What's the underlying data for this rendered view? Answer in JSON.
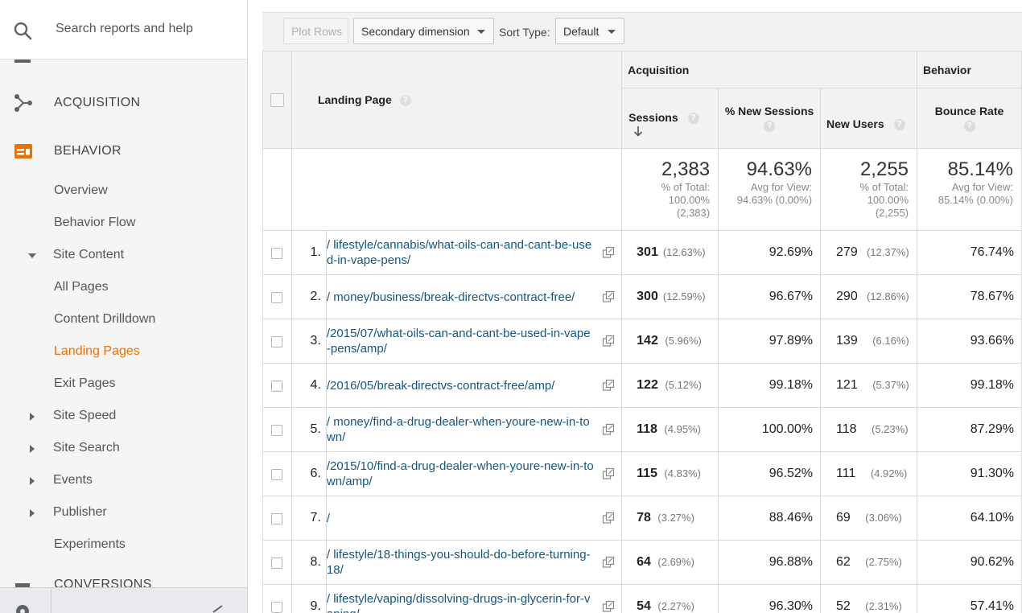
{
  "sidebar": {
    "search_placeholder": "Search reports and help",
    "sections": {
      "acquisition": "ACQUISITION",
      "behavior": "BEHAVIOR",
      "conversions": "CONVERSIONS"
    },
    "items": [
      {
        "label": "Overview"
      },
      {
        "label": "Behavior Flow"
      },
      {
        "label": "Site Content"
      },
      {
        "label": "All Pages"
      },
      {
        "label": "Content Drilldown"
      },
      {
        "label": "Landing Pages"
      },
      {
        "label": "Exit Pages"
      },
      {
        "label": "Site Speed"
      },
      {
        "label": "Site Search"
      },
      {
        "label": "Events"
      },
      {
        "label": "Publisher"
      },
      {
        "label": "Experiments"
      }
    ],
    "accent_color": "#e8710a"
  },
  "toolbar": {
    "plot_rows": "Plot Rows",
    "secondary_dimension": "Secondary dimension",
    "sort_type_label": "Sort Type:",
    "sort_type_value": "Default"
  },
  "table": {
    "groups": {
      "acquisition": "Acquisition",
      "behavior": "Behavior"
    },
    "columns": {
      "landing_page": "Landing Page",
      "sessions": "Sessions",
      "pct_new_sessions": "% New Sessions",
      "new_users": "New Users",
      "bounce_rate": "Bounce Rate"
    },
    "totals": {
      "sessions": {
        "value": "2,383",
        "l1": "% of Total:",
        "l2": "100.00%",
        "l3": "(2,383)"
      },
      "pct_new_sessions": {
        "value": "94.63%",
        "l1": "Avg for View:",
        "l2": "94.63% (0.00%)"
      },
      "new_users": {
        "value": "2,255",
        "l1": "% of Total:",
        "l2": "100.00%",
        "l3": "(2,255)"
      },
      "bounce_rate": {
        "value": "85.14%",
        "l1": "Avg for View:",
        "l2": "85.14% (0.00%)"
      }
    },
    "rows": [
      {
        "idx": "1.",
        "page": "/ lifestyle/cannabis/what-oils-can-and-cant-be-used-in-vape-pens/",
        "sessions": "301",
        "sessions_pct": "(12.63%)",
        "new_sessions": "92.69%",
        "new_users": "279",
        "new_users_pct": "(12.37%)",
        "bounce": "76.74%"
      },
      {
        "idx": "2.",
        "page": "/ money/business/break-directvs-contract-free/",
        "sessions": "300",
        "sessions_pct": "(12.59%)",
        "new_sessions": "96.67%",
        "new_users": "290",
        "new_users_pct": "(12.86%)",
        "bounce": "78.67%"
      },
      {
        "idx": "3.",
        "page": "/2015/07/what-oils-can-and-cant-be-used-in-vape-pens/amp/",
        "sessions": "142",
        "sessions_pct": "(5.96%)",
        "new_sessions": "97.89%",
        "new_users": "139",
        "new_users_pct": "(6.16%)",
        "bounce": "93.66%"
      },
      {
        "idx": "4.",
        "page": "/2016/05/break-directvs-contract-free/amp/",
        "sessions": "122",
        "sessions_pct": "(5.12%)",
        "new_sessions": "99.18%",
        "new_users": "121",
        "new_users_pct": "(5.37%)",
        "bounce": "99.18%"
      },
      {
        "idx": "5.",
        "page": "/ money/find-a-drug-dealer-when-youre-new-in-town/",
        "sessions": "118",
        "sessions_pct": "(4.95%)",
        "new_sessions": "100.00%",
        "new_users": "118",
        "new_users_pct": "(5.23%)",
        "bounce": "87.29%"
      },
      {
        "idx": "6.",
        "page": "/2015/10/find-a-drug-dealer-when-youre-new-in-town/amp/",
        "sessions": "115",
        "sessions_pct": "(4.83%)",
        "new_sessions": "96.52%",
        "new_users": "111",
        "new_users_pct": "(4.92%)",
        "bounce": "91.30%"
      },
      {
        "idx": "7.",
        "page": "/",
        "sessions": "78",
        "sessions_pct": "(3.27%)",
        "new_sessions": "88.46%",
        "new_users": "69",
        "new_users_pct": "(3.06%)",
        "bounce": "64.10%"
      },
      {
        "idx": "8.",
        "page": "/ lifestyle/18-things-you-should-do-before-turning-18/",
        "sessions": "64",
        "sessions_pct": "(2.69%)",
        "new_sessions": "96.88%",
        "new_users": "62",
        "new_users_pct": "(2.75%)",
        "bounce": "90.62%"
      },
      {
        "idx": "9.",
        "page": "/ lifestyle/vaping/dissolving-drugs-in-glycerin-for-vaping/",
        "sessions": "54",
        "sessions_pct": "(2.27%)",
        "new_sessions": "96.30%",
        "new_users": "52",
        "new_users_pct": "(2.31%)",
        "bounce": "57.41%"
      }
    ]
  }
}
